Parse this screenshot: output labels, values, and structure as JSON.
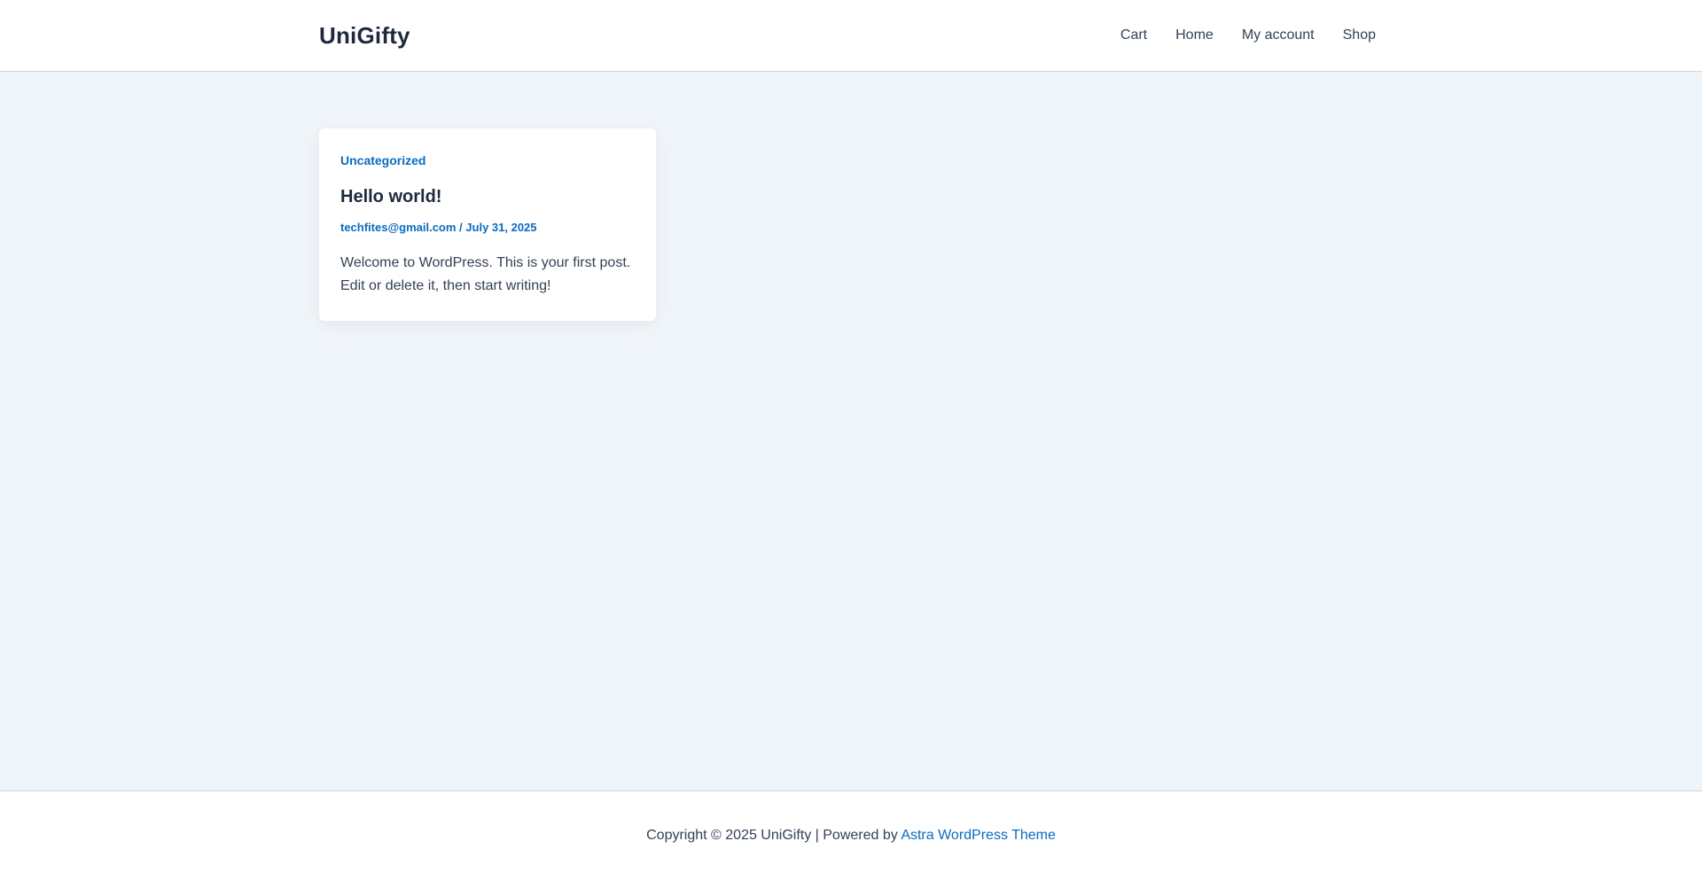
{
  "header": {
    "site_title": "UniGifty",
    "nav": [
      {
        "label": "Cart"
      },
      {
        "label": "Home"
      },
      {
        "label": "My account"
      },
      {
        "label": "Shop"
      }
    ]
  },
  "post": {
    "category": "Uncategorized",
    "title": "Hello world!",
    "author": "techfites@gmail.com",
    "separator": " / ",
    "date": "July 31, 2025",
    "excerpt": "Welcome to WordPress. This is your first post. Edit or delete it, then start writing!"
  },
  "footer": {
    "copyright": "Copyright © 2025 UniGifty | Powered by ",
    "theme_link": "Astra WordPress Theme"
  },
  "colors": {
    "background": "#f0f5fa",
    "accent": "#0b6bbf",
    "heading": "#1e293b",
    "text": "#334155"
  }
}
